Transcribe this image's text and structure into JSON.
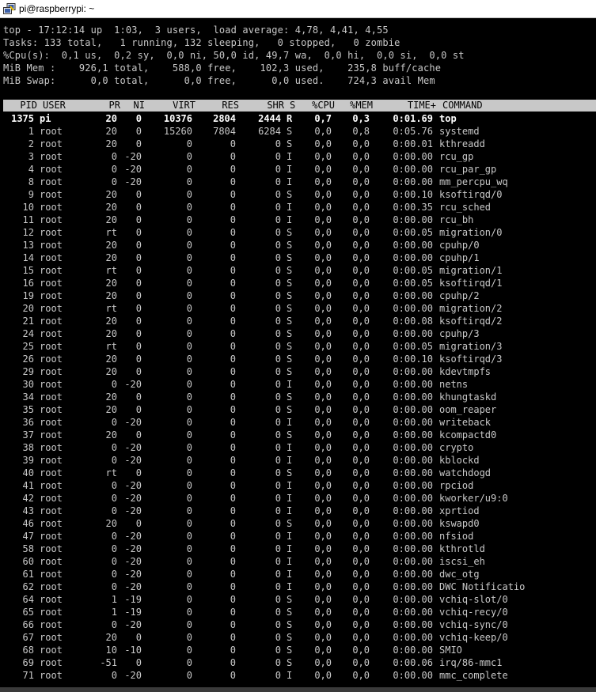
{
  "window": {
    "title": "pi@raspberrypi: ~",
    "icon": "putty-icon"
  },
  "summary": [
    "top - 17:12:14 up  1:03,  3 users,  load average: 4,78, 4,41, 4,55",
    "Tasks: 133 total,   1 running, 132 sleeping,   0 stopped,   0 zombie",
    "%Cpu(s):  0,1 us,  0,2 sy,  0,0 ni, 50,0 id, 49,7 wa,  0,0 hi,  0,0 si,  0,0 st",
    "MiB Mem :    926,1 total,    588,0 free,    102,3 used,    235,8 buff/cache",
    "MiB Swap:      0,0 total,      0,0 free,      0,0 used.    724,3 avail Mem"
  ],
  "columns": {
    "pid": "PID",
    "user": "USER",
    "pr": "PR",
    "ni": "NI",
    "virt": "VIRT",
    "res": "RES",
    "shr": "SHR",
    "s": "S",
    "cpu": "%CPU",
    "mem": "%MEM",
    "time": "TIME+",
    "command": "COMMAND"
  },
  "processes": [
    {
      "pid": "1375",
      "user": "pi",
      "pr": "20",
      "ni": "0",
      "virt": "10376",
      "res": "2804",
      "shr": "2444",
      "s": "R",
      "cpu": "0,7",
      "mem": "0,3",
      "time": "0:01.69",
      "command": "top"
    },
    {
      "pid": "1",
      "user": "root",
      "pr": "20",
      "ni": "0",
      "virt": "15260",
      "res": "7804",
      "shr": "6284",
      "s": "S",
      "cpu": "0,0",
      "mem": "0,8",
      "time": "0:05.76",
      "command": "systemd"
    },
    {
      "pid": "2",
      "user": "root",
      "pr": "20",
      "ni": "0",
      "virt": "0",
      "res": "0",
      "shr": "0",
      "s": "S",
      "cpu": "0,0",
      "mem": "0,0",
      "time": "0:00.01",
      "command": "kthreadd"
    },
    {
      "pid": "3",
      "user": "root",
      "pr": "0",
      "ni": "-20",
      "virt": "0",
      "res": "0",
      "shr": "0",
      "s": "I",
      "cpu": "0,0",
      "mem": "0,0",
      "time": "0:00.00",
      "command": "rcu_gp"
    },
    {
      "pid": "4",
      "user": "root",
      "pr": "0",
      "ni": "-20",
      "virt": "0",
      "res": "0",
      "shr": "0",
      "s": "I",
      "cpu": "0,0",
      "mem": "0,0",
      "time": "0:00.00",
      "command": "rcu_par_gp"
    },
    {
      "pid": "8",
      "user": "root",
      "pr": "0",
      "ni": "-20",
      "virt": "0",
      "res": "0",
      "shr": "0",
      "s": "I",
      "cpu": "0,0",
      "mem": "0,0",
      "time": "0:00.00",
      "command": "mm_percpu_wq"
    },
    {
      "pid": "9",
      "user": "root",
      "pr": "20",
      "ni": "0",
      "virt": "0",
      "res": "0",
      "shr": "0",
      "s": "S",
      "cpu": "0,0",
      "mem": "0,0",
      "time": "0:00.10",
      "command": "ksoftirqd/0"
    },
    {
      "pid": "10",
      "user": "root",
      "pr": "20",
      "ni": "0",
      "virt": "0",
      "res": "0",
      "shr": "0",
      "s": "I",
      "cpu": "0,0",
      "mem": "0,0",
      "time": "0:00.35",
      "command": "rcu_sched"
    },
    {
      "pid": "11",
      "user": "root",
      "pr": "20",
      "ni": "0",
      "virt": "0",
      "res": "0",
      "shr": "0",
      "s": "I",
      "cpu": "0,0",
      "mem": "0,0",
      "time": "0:00.00",
      "command": "rcu_bh"
    },
    {
      "pid": "12",
      "user": "root",
      "pr": "rt",
      "ni": "0",
      "virt": "0",
      "res": "0",
      "shr": "0",
      "s": "S",
      "cpu": "0,0",
      "mem": "0,0",
      "time": "0:00.05",
      "command": "migration/0"
    },
    {
      "pid": "13",
      "user": "root",
      "pr": "20",
      "ni": "0",
      "virt": "0",
      "res": "0",
      "shr": "0",
      "s": "S",
      "cpu": "0,0",
      "mem": "0,0",
      "time": "0:00.00",
      "command": "cpuhp/0"
    },
    {
      "pid": "14",
      "user": "root",
      "pr": "20",
      "ni": "0",
      "virt": "0",
      "res": "0",
      "shr": "0",
      "s": "S",
      "cpu": "0,0",
      "mem": "0,0",
      "time": "0:00.00",
      "command": "cpuhp/1"
    },
    {
      "pid": "15",
      "user": "root",
      "pr": "rt",
      "ni": "0",
      "virt": "0",
      "res": "0",
      "shr": "0",
      "s": "S",
      "cpu": "0,0",
      "mem": "0,0",
      "time": "0:00.05",
      "command": "migration/1"
    },
    {
      "pid": "16",
      "user": "root",
      "pr": "20",
      "ni": "0",
      "virt": "0",
      "res": "0",
      "shr": "0",
      "s": "S",
      "cpu": "0,0",
      "mem": "0,0",
      "time": "0:00.05",
      "command": "ksoftirqd/1"
    },
    {
      "pid": "19",
      "user": "root",
      "pr": "20",
      "ni": "0",
      "virt": "0",
      "res": "0",
      "shr": "0",
      "s": "S",
      "cpu": "0,0",
      "mem": "0,0",
      "time": "0:00.00",
      "command": "cpuhp/2"
    },
    {
      "pid": "20",
      "user": "root",
      "pr": "rt",
      "ni": "0",
      "virt": "0",
      "res": "0",
      "shr": "0",
      "s": "S",
      "cpu": "0,0",
      "mem": "0,0",
      "time": "0:00.00",
      "command": "migration/2"
    },
    {
      "pid": "21",
      "user": "root",
      "pr": "20",
      "ni": "0",
      "virt": "0",
      "res": "0",
      "shr": "0",
      "s": "S",
      "cpu": "0,0",
      "mem": "0,0",
      "time": "0:00.08",
      "command": "ksoftirqd/2"
    },
    {
      "pid": "24",
      "user": "root",
      "pr": "20",
      "ni": "0",
      "virt": "0",
      "res": "0",
      "shr": "0",
      "s": "S",
      "cpu": "0,0",
      "mem": "0,0",
      "time": "0:00.00",
      "command": "cpuhp/3"
    },
    {
      "pid": "25",
      "user": "root",
      "pr": "rt",
      "ni": "0",
      "virt": "0",
      "res": "0",
      "shr": "0",
      "s": "S",
      "cpu": "0,0",
      "mem": "0,0",
      "time": "0:00.05",
      "command": "migration/3"
    },
    {
      "pid": "26",
      "user": "root",
      "pr": "20",
      "ni": "0",
      "virt": "0",
      "res": "0",
      "shr": "0",
      "s": "S",
      "cpu": "0,0",
      "mem": "0,0",
      "time": "0:00.10",
      "command": "ksoftirqd/3"
    },
    {
      "pid": "29",
      "user": "root",
      "pr": "20",
      "ni": "0",
      "virt": "0",
      "res": "0",
      "shr": "0",
      "s": "S",
      "cpu": "0,0",
      "mem": "0,0",
      "time": "0:00.00",
      "command": "kdevtmpfs"
    },
    {
      "pid": "30",
      "user": "root",
      "pr": "0",
      "ni": "-20",
      "virt": "0",
      "res": "0",
      "shr": "0",
      "s": "I",
      "cpu": "0,0",
      "mem": "0,0",
      "time": "0:00.00",
      "command": "netns"
    },
    {
      "pid": "34",
      "user": "root",
      "pr": "20",
      "ni": "0",
      "virt": "0",
      "res": "0",
      "shr": "0",
      "s": "S",
      "cpu": "0,0",
      "mem": "0,0",
      "time": "0:00.00",
      "command": "khungtaskd"
    },
    {
      "pid": "35",
      "user": "root",
      "pr": "20",
      "ni": "0",
      "virt": "0",
      "res": "0",
      "shr": "0",
      "s": "S",
      "cpu": "0,0",
      "mem": "0,0",
      "time": "0:00.00",
      "command": "oom_reaper"
    },
    {
      "pid": "36",
      "user": "root",
      "pr": "0",
      "ni": "-20",
      "virt": "0",
      "res": "0",
      "shr": "0",
      "s": "I",
      "cpu": "0,0",
      "mem": "0,0",
      "time": "0:00.00",
      "command": "writeback"
    },
    {
      "pid": "37",
      "user": "root",
      "pr": "20",
      "ni": "0",
      "virt": "0",
      "res": "0",
      "shr": "0",
      "s": "S",
      "cpu": "0,0",
      "mem": "0,0",
      "time": "0:00.00",
      "command": "kcompactd0"
    },
    {
      "pid": "38",
      "user": "root",
      "pr": "0",
      "ni": "-20",
      "virt": "0",
      "res": "0",
      "shr": "0",
      "s": "I",
      "cpu": "0,0",
      "mem": "0,0",
      "time": "0:00.00",
      "command": "crypto"
    },
    {
      "pid": "39",
      "user": "root",
      "pr": "0",
      "ni": "-20",
      "virt": "0",
      "res": "0",
      "shr": "0",
      "s": "I",
      "cpu": "0,0",
      "mem": "0,0",
      "time": "0:00.00",
      "command": "kblockd"
    },
    {
      "pid": "40",
      "user": "root",
      "pr": "rt",
      "ni": "0",
      "virt": "0",
      "res": "0",
      "shr": "0",
      "s": "S",
      "cpu": "0,0",
      "mem": "0,0",
      "time": "0:00.00",
      "command": "watchdogd"
    },
    {
      "pid": "41",
      "user": "root",
      "pr": "0",
      "ni": "-20",
      "virt": "0",
      "res": "0",
      "shr": "0",
      "s": "I",
      "cpu": "0,0",
      "mem": "0,0",
      "time": "0:00.00",
      "command": "rpciod"
    },
    {
      "pid": "42",
      "user": "root",
      "pr": "0",
      "ni": "-20",
      "virt": "0",
      "res": "0",
      "shr": "0",
      "s": "I",
      "cpu": "0,0",
      "mem": "0,0",
      "time": "0:00.00",
      "command": "kworker/u9:0"
    },
    {
      "pid": "43",
      "user": "root",
      "pr": "0",
      "ni": "-20",
      "virt": "0",
      "res": "0",
      "shr": "0",
      "s": "I",
      "cpu": "0,0",
      "mem": "0,0",
      "time": "0:00.00",
      "command": "xprtiod"
    },
    {
      "pid": "46",
      "user": "root",
      "pr": "20",
      "ni": "0",
      "virt": "0",
      "res": "0",
      "shr": "0",
      "s": "S",
      "cpu": "0,0",
      "mem": "0,0",
      "time": "0:00.00",
      "command": "kswapd0"
    },
    {
      "pid": "47",
      "user": "root",
      "pr": "0",
      "ni": "-20",
      "virt": "0",
      "res": "0",
      "shr": "0",
      "s": "I",
      "cpu": "0,0",
      "mem": "0,0",
      "time": "0:00.00",
      "command": "nfsiod"
    },
    {
      "pid": "58",
      "user": "root",
      "pr": "0",
      "ni": "-20",
      "virt": "0",
      "res": "0",
      "shr": "0",
      "s": "I",
      "cpu": "0,0",
      "mem": "0,0",
      "time": "0:00.00",
      "command": "kthrotld"
    },
    {
      "pid": "60",
      "user": "root",
      "pr": "0",
      "ni": "-20",
      "virt": "0",
      "res": "0",
      "shr": "0",
      "s": "I",
      "cpu": "0,0",
      "mem": "0,0",
      "time": "0:00.00",
      "command": "iscsi_eh"
    },
    {
      "pid": "61",
      "user": "root",
      "pr": "0",
      "ni": "-20",
      "virt": "0",
      "res": "0",
      "shr": "0",
      "s": "I",
      "cpu": "0,0",
      "mem": "0,0",
      "time": "0:00.00",
      "command": "dwc_otg"
    },
    {
      "pid": "62",
      "user": "root",
      "pr": "0",
      "ni": "-20",
      "virt": "0",
      "res": "0",
      "shr": "0",
      "s": "I",
      "cpu": "0,0",
      "mem": "0,0",
      "time": "0:00.00",
      "command": "DWC Notificatio"
    },
    {
      "pid": "64",
      "user": "root",
      "pr": "1",
      "ni": "-19",
      "virt": "0",
      "res": "0",
      "shr": "0",
      "s": "S",
      "cpu": "0,0",
      "mem": "0,0",
      "time": "0:00.00",
      "command": "vchiq-slot/0"
    },
    {
      "pid": "65",
      "user": "root",
      "pr": "1",
      "ni": "-19",
      "virt": "0",
      "res": "0",
      "shr": "0",
      "s": "S",
      "cpu": "0,0",
      "mem": "0,0",
      "time": "0:00.00",
      "command": "vchiq-recy/0"
    },
    {
      "pid": "66",
      "user": "root",
      "pr": "0",
      "ni": "-20",
      "virt": "0",
      "res": "0",
      "shr": "0",
      "s": "S",
      "cpu": "0,0",
      "mem": "0,0",
      "time": "0:00.00",
      "command": "vchiq-sync/0"
    },
    {
      "pid": "67",
      "user": "root",
      "pr": "20",
      "ni": "0",
      "virt": "0",
      "res": "0",
      "shr": "0",
      "s": "S",
      "cpu": "0,0",
      "mem": "0,0",
      "time": "0:00.00",
      "command": "vchiq-keep/0"
    },
    {
      "pid": "68",
      "user": "root",
      "pr": "10",
      "ni": "-10",
      "virt": "0",
      "res": "0",
      "shr": "0",
      "s": "S",
      "cpu": "0,0",
      "mem": "0,0",
      "time": "0:00.00",
      "command": "SMIO"
    },
    {
      "pid": "69",
      "user": "root",
      "pr": "-51",
      "ni": "0",
      "virt": "0",
      "res": "0",
      "shr": "0",
      "s": "S",
      "cpu": "0,0",
      "mem": "0,0",
      "time": "0:00.06",
      "command": "irq/86-mmc1"
    },
    {
      "pid": "71",
      "user": "root",
      "pr": "0",
      "ni": "-20",
      "virt": "0",
      "res": "0",
      "shr": "0",
      "s": "I",
      "cpu": "0,0",
      "mem": "0,0",
      "time": "0:00.00",
      "command": "mmc_complete"
    }
  ]
}
